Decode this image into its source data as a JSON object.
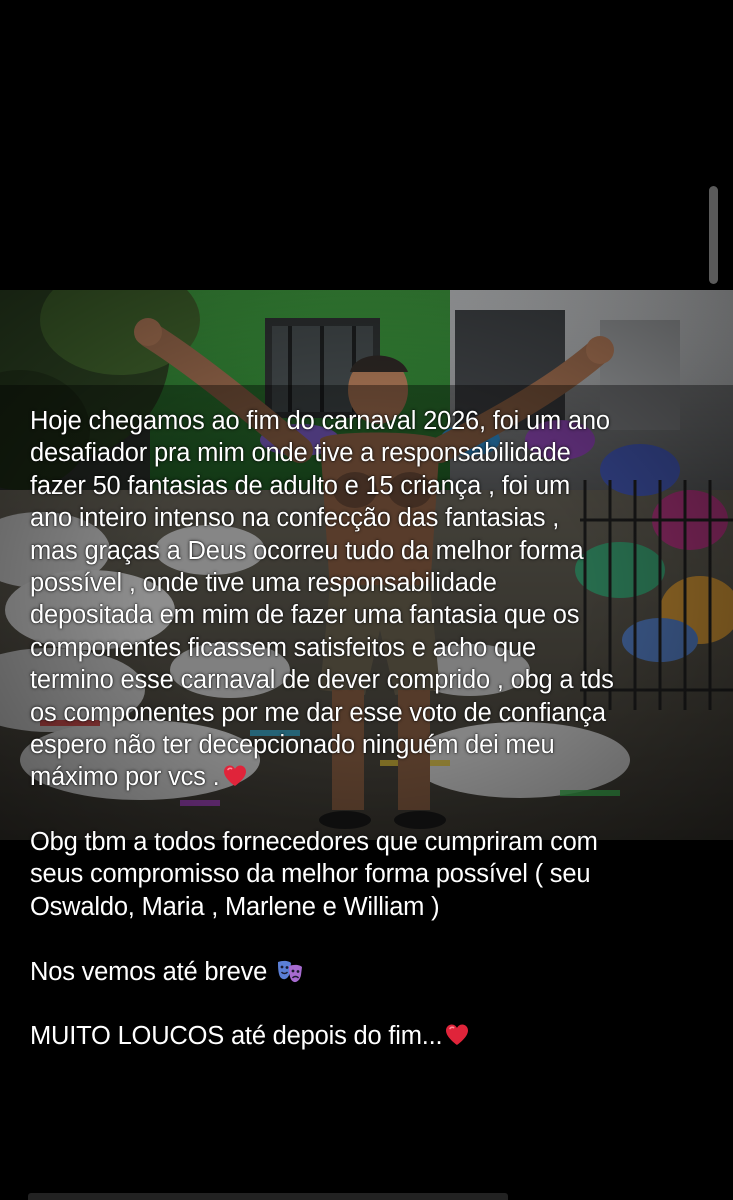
{
  "story": {
    "caption_lines": [
      "Hoje chegamos ao fim do carnaval 2026, foi um ano",
      "desafiador pra mim onde tive a responsabilidade",
      "fazer 50 fantasias de adulto e 15 criança , foi um",
      "ano inteiro intenso na confecção das fantasias ,",
      "mas graças a Deus ocorreu tudo da melhor forma",
      "possível  , onde tive uma responsabilidade",
      "depositada em mim de fazer uma fantasia que os",
      "componentes ficassem satisfeitos e acho que",
      "termino esse carnaval de dever comprido , obg a tds",
      "os componentes por me dar esse voto de confiança",
      "espero não ter decepcionado ninguém dei meu",
      "máximo por vcs ."
    ],
    "thanks_lines": [
      "Obg tbm a todos fornecedores que cumpriram com",
      "seus compromisso da melhor forma possível ( seu",
      "Oswaldo, Maria , Marlene e William )"
    ],
    "see_you": "Nos vemos até breve",
    "closing": "MUITO LOUCOS até depois do fim..."
  },
  "icons": {
    "heart": "red-heart-icon",
    "masks": "performing-arts-masks-icon"
  },
  "colors": {
    "background": "#000000",
    "text": "#ffffff",
    "heart": "#e0243a"
  }
}
